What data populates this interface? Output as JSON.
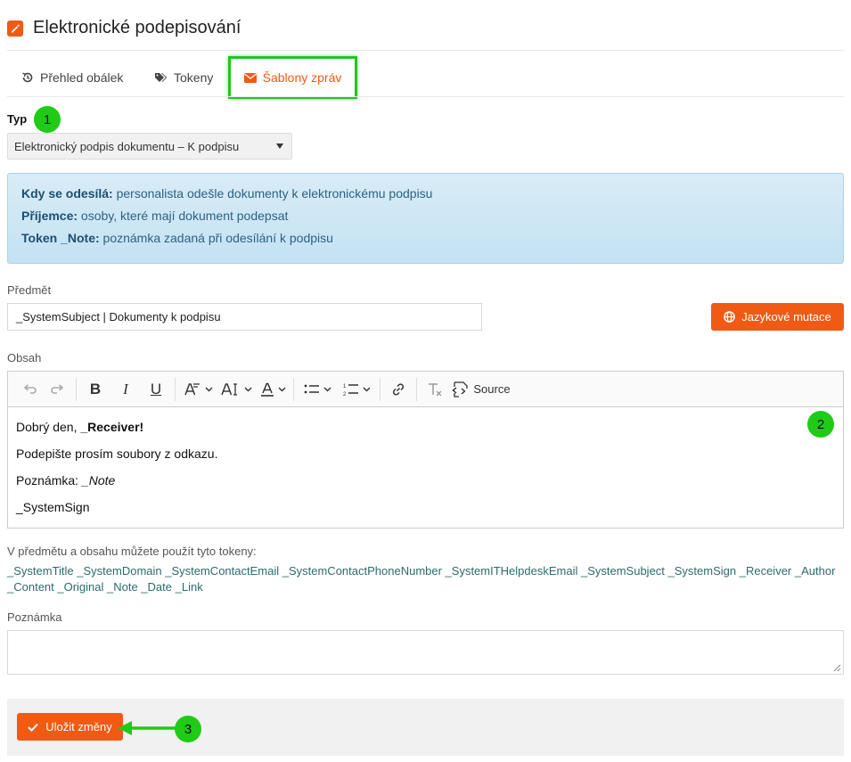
{
  "header": {
    "title": "Elektronické podepisování",
    "icon": "edit-icon"
  },
  "tabs": [
    {
      "label": "Přehled obálek",
      "icon": "history-icon"
    },
    {
      "label": "Tokeny",
      "icon": "tags-icon"
    },
    {
      "label": "Šablony zpráv",
      "icon": "envelope-icon",
      "active": true
    }
  ],
  "type_field": {
    "label": "Typ",
    "value": "Elektronický podpis dokumentu – K podpisu"
  },
  "info": {
    "line1_key": "Kdy se odesílá:",
    "line1_text": " personalista odešle dokumenty k elektronickému podpisu",
    "line2_key": "Příjemce:",
    "line2_text": " osoby, které mají dokument podepsat",
    "line3_key": "Token _Note:",
    "line3_text": " poznámka zadaná při odesílání k podpisu"
  },
  "subject": {
    "label": "Předmět",
    "value": "_SystemSubject | Dokumenty k podpisu"
  },
  "lang_button": "Jazykové mutace",
  "body_field": {
    "label": "Obsah"
  },
  "toolbar": {
    "source_label": "Source"
  },
  "editor": {
    "line1_prefix": "Dobrý den, ",
    "line1_bold": "_Receiver!",
    "line2": "Podepište prosím soubory z odkazu.",
    "line3_prefix": "Poznámka: ",
    "line3_italic": "_Note",
    "line4": "_SystemSign"
  },
  "tokens": {
    "label": "V předmětu a obsahu můžete použít tyto tokeny:",
    "list": "_SystemTitle _SystemDomain _SystemContactEmail _SystemContactPhoneNumber _SystemITHelpdeskEmail _SystemSubject _SystemSign _Receiver _Author _Content _Original _Note _Date _Link"
  },
  "note": {
    "label": "Poznámka",
    "value": ""
  },
  "save_button": "Uložit změny",
  "callouts": {
    "b1": "1",
    "b2": "2",
    "b3": "3"
  },
  "colors": {
    "accent": "#f05a13",
    "callout": "#1fcb17",
    "info_text": "#2d6283",
    "token_text": "#2d6a6e"
  }
}
